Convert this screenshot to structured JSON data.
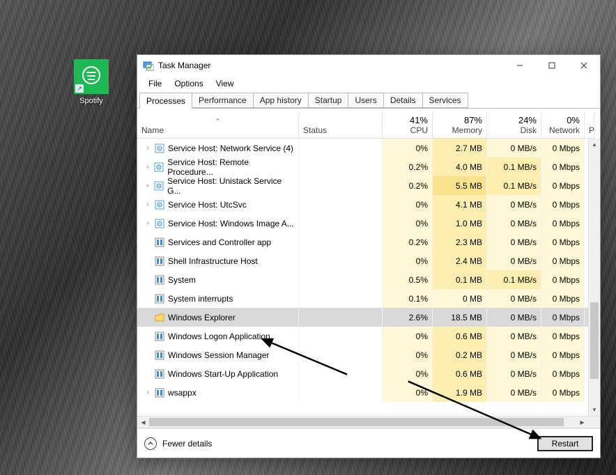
{
  "desktop": {
    "shortcut": {
      "label": "Spotify"
    }
  },
  "window": {
    "title": "Task Manager",
    "menu": {
      "file": "File",
      "options": "Options",
      "view": "View"
    },
    "tabs": {
      "processes": "Processes",
      "performance": "Performance",
      "app_history": "App history",
      "startup": "Startup",
      "users": "Users",
      "details": "Details",
      "services": "Services"
    },
    "columns": {
      "name": "Name",
      "status": "Status",
      "cpu": "CPU",
      "cpu_head": "41%",
      "memory": "Memory",
      "memory_head": "87%",
      "disk": "Disk",
      "disk_head": "24%",
      "network": "Network",
      "network_head": "0%",
      "p": "P"
    },
    "footer": {
      "fewer_details": "Fewer details",
      "restart": "Restart"
    }
  },
  "processes": [
    {
      "exp": true,
      "icon": "gear",
      "name": "Service Host: Network Service (4)",
      "cpu": "0%",
      "mem": "2.7 MB",
      "disk": "0 MB/s",
      "net": "0 Mbps",
      "h": [
        1,
        2,
        1,
        1
      ]
    },
    {
      "exp": true,
      "icon": "gear",
      "name": "Service Host: Remote Procedure...",
      "cpu": "0.2%",
      "mem": "4.0 MB",
      "disk": "0.1 MB/s",
      "net": "0 Mbps",
      "h": [
        1,
        2,
        2,
        1
      ]
    },
    {
      "exp": true,
      "icon": "gear",
      "name": "Service Host: Unistack Service G...",
      "cpu": "0.2%",
      "mem": "5.5 MB",
      "disk": "0.1 MB/s",
      "net": "0 Mbps",
      "h": [
        1,
        3,
        2,
        1
      ]
    },
    {
      "exp": true,
      "icon": "gear",
      "name": "Service Host: UtcSvc",
      "cpu": "0%",
      "mem": "4.1 MB",
      "disk": "0 MB/s",
      "net": "0 Mbps",
      "h": [
        1,
        2,
        1,
        1
      ]
    },
    {
      "exp": true,
      "icon": "gear",
      "name": "Service Host: Windows Image A...",
      "cpu": "0%",
      "mem": "1.0 MB",
      "disk": "0 MB/s",
      "net": "0 Mbps",
      "h": [
        1,
        2,
        1,
        1
      ]
    },
    {
      "exp": false,
      "icon": "app",
      "name": "Services and Controller app",
      "cpu": "0.2%",
      "mem": "2.3 MB",
      "disk": "0 MB/s",
      "net": "0 Mbps",
      "h": [
        1,
        2,
        1,
        1
      ]
    },
    {
      "exp": false,
      "icon": "app",
      "name": "Shell Infrastructure Host",
      "cpu": "0%",
      "mem": "2.4 MB",
      "disk": "0 MB/s",
      "net": "0 Mbps",
      "h": [
        1,
        2,
        1,
        1
      ]
    },
    {
      "exp": false,
      "icon": "app",
      "name": "System",
      "cpu": "0.5%",
      "mem": "0.1 MB",
      "disk": "0.1 MB/s",
      "net": "0 Mbps",
      "h": [
        1,
        2,
        2,
        1
      ]
    },
    {
      "exp": false,
      "icon": "app",
      "name": "System interrupts",
      "cpu": "0.1%",
      "mem": "0 MB",
      "disk": "0 MB/s",
      "net": "0 Mbps",
      "h": [
        1,
        1,
        1,
        1
      ]
    },
    {
      "exp": false,
      "icon": "folder",
      "name": "Windows Explorer",
      "cpu": "2.6%",
      "mem": "18.5 MB",
      "disk": "0 MB/s",
      "net": "0 Mbps",
      "h": [
        2,
        3,
        1,
        1
      ],
      "selected": true
    },
    {
      "exp": false,
      "icon": "app",
      "name": "Windows Logon Application",
      "cpu": "0%",
      "mem": "0.6 MB",
      "disk": "0 MB/s",
      "net": "0 Mbps",
      "h": [
        1,
        2,
        1,
        1
      ]
    },
    {
      "exp": false,
      "icon": "app",
      "name": "Windows Session Manager",
      "cpu": "0%",
      "mem": "0.2 MB",
      "disk": "0 MB/s",
      "net": "0 Mbps",
      "h": [
        1,
        2,
        1,
        1
      ]
    },
    {
      "exp": false,
      "icon": "app",
      "name": "Windows Start-Up Application",
      "cpu": "0%",
      "mem": "0.6 MB",
      "disk": "0 MB/s",
      "net": "0 Mbps",
      "h": [
        1,
        2,
        1,
        1
      ]
    },
    {
      "exp": true,
      "icon": "app",
      "name": "wsappx",
      "cpu": "0%",
      "mem": "1.9 MB",
      "disk": "0 MB/s",
      "net": "0 Mbps",
      "h": [
        1,
        2,
        1,
        1
      ]
    }
  ]
}
